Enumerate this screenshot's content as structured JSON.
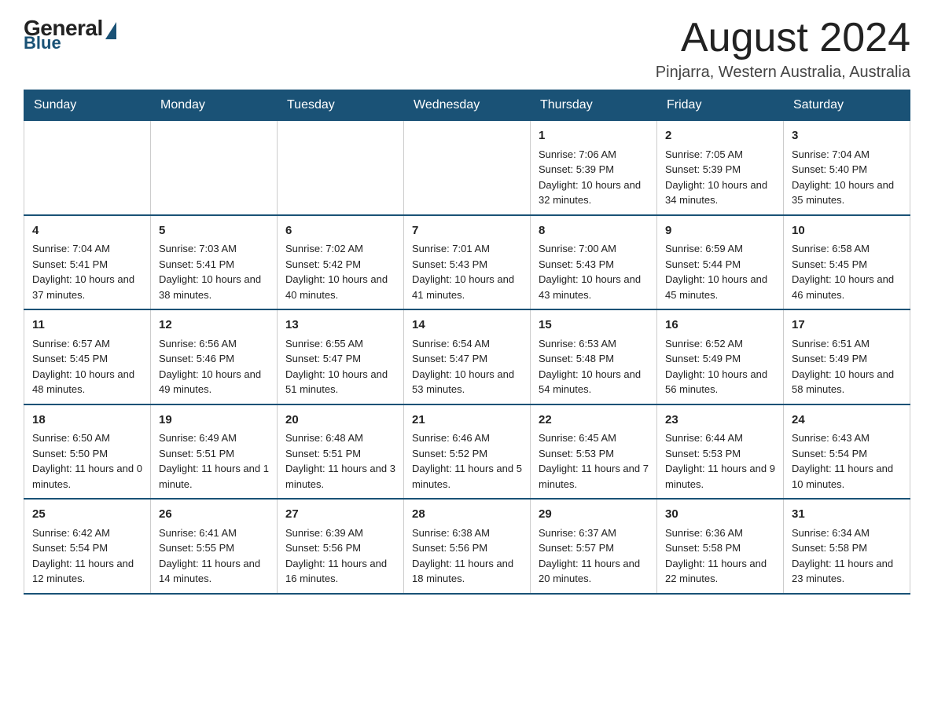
{
  "logo": {
    "general": "General",
    "blue": "Blue"
  },
  "title": "August 2024",
  "location": "Pinjarra, Western Australia, Australia",
  "days_of_week": [
    "Sunday",
    "Monday",
    "Tuesday",
    "Wednesday",
    "Thursday",
    "Friday",
    "Saturday"
  ],
  "weeks": [
    [
      {
        "day": "",
        "info": ""
      },
      {
        "day": "",
        "info": ""
      },
      {
        "day": "",
        "info": ""
      },
      {
        "day": "",
        "info": ""
      },
      {
        "day": "1",
        "info": "Sunrise: 7:06 AM\nSunset: 5:39 PM\nDaylight: 10 hours and 32 minutes."
      },
      {
        "day": "2",
        "info": "Sunrise: 7:05 AM\nSunset: 5:39 PM\nDaylight: 10 hours and 34 minutes."
      },
      {
        "day": "3",
        "info": "Sunrise: 7:04 AM\nSunset: 5:40 PM\nDaylight: 10 hours and 35 minutes."
      }
    ],
    [
      {
        "day": "4",
        "info": "Sunrise: 7:04 AM\nSunset: 5:41 PM\nDaylight: 10 hours and 37 minutes."
      },
      {
        "day": "5",
        "info": "Sunrise: 7:03 AM\nSunset: 5:41 PM\nDaylight: 10 hours and 38 minutes."
      },
      {
        "day": "6",
        "info": "Sunrise: 7:02 AM\nSunset: 5:42 PM\nDaylight: 10 hours and 40 minutes."
      },
      {
        "day": "7",
        "info": "Sunrise: 7:01 AM\nSunset: 5:43 PM\nDaylight: 10 hours and 41 minutes."
      },
      {
        "day": "8",
        "info": "Sunrise: 7:00 AM\nSunset: 5:43 PM\nDaylight: 10 hours and 43 minutes."
      },
      {
        "day": "9",
        "info": "Sunrise: 6:59 AM\nSunset: 5:44 PM\nDaylight: 10 hours and 45 minutes."
      },
      {
        "day": "10",
        "info": "Sunrise: 6:58 AM\nSunset: 5:45 PM\nDaylight: 10 hours and 46 minutes."
      }
    ],
    [
      {
        "day": "11",
        "info": "Sunrise: 6:57 AM\nSunset: 5:45 PM\nDaylight: 10 hours and 48 minutes."
      },
      {
        "day": "12",
        "info": "Sunrise: 6:56 AM\nSunset: 5:46 PM\nDaylight: 10 hours and 49 minutes."
      },
      {
        "day": "13",
        "info": "Sunrise: 6:55 AM\nSunset: 5:47 PM\nDaylight: 10 hours and 51 minutes."
      },
      {
        "day": "14",
        "info": "Sunrise: 6:54 AM\nSunset: 5:47 PM\nDaylight: 10 hours and 53 minutes."
      },
      {
        "day": "15",
        "info": "Sunrise: 6:53 AM\nSunset: 5:48 PM\nDaylight: 10 hours and 54 minutes."
      },
      {
        "day": "16",
        "info": "Sunrise: 6:52 AM\nSunset: 5:49 PM\nDaylight: 10 hours and 56 minutes."
      },
      {
        "day": "17",
        "info": "Sunrise: 6:51 AM\nSunset: 5:49 PM\nDaylight: 10 hours and 58 minutes."
      }
    ],
    [
      {
        "day": "18",
        "info": "Sunrise: 6:50 AM\nSunset: 5:50 PM\nDaylight: 11 hours and 0 minutes."
      },
      {
        "day": "19",
        "info": "Sunrise: 6:49 AM\nSunset: 5:51 PM\nDaylight: 11 hours and 1 minute."
      },
      {
        "day": "20",
        "info": "Sunrise: 6:48 AM\nSunset: 5:51 PM\nDaylight: 11 hours and 3 minutes."
      },
      {
        "day": "21",
        "info": "Sunrise: 6:46 AM\nSunset: 5:52 PM\nDaylight: 11 hours and 5 minutes."
      },
      {
        "day": "22",
        "info": "Sunrise: 6:45 AM\nSunset: 5:53 PM\nDaylight: 11 hours and 7 minutes."
      },
      {
        "day": "23",
        "info": "Sunrise: 6:44 AM\nSunset: 5:53 PM\nDaylight: 11 hours and 9 minutes."
      },
      {
        "day": "24",
        "info": "Sunrise: 6:43 AM\nSunset: 5:54 PM\nDaylight: 11 hours and 10 minutes."
      }
    ],
    [
      {
        "day": "25",
        "info": "Sunrise: 6:42 AM\nSunset: 5:54 PM\nDaylight: 11 hours and 12 minutes."
      },
      {
        "day": "26",
        "info": "Sunrise: 6:41 AM\nSunset: 5:55 PM\nDaylight: 11 hours and 14 minutes."
      },
      {
        "day": "27",
        "info": "Sunrise: 6:39 AM\nSunset: 5:56 PM\nDaylight: 11 hours and 16 minutes."
      },
      {
        "day": "28",
        "info": "Sunrise: 6:38 AM\nSunset: 5:56 PM\nDaylight: 11 hours and 18 minutes."
      },
      {
        "day": "29",
        "info": "Sunrise: 6:37 AM\nSunset: 5:57 PM\nDaylight: 11 hours and 20 minutes."
      },
      {
        "day": "30",
        "info": "Sunrise: 6:36 AM\nSunset: 5:58 PM\nDaylight: 11 hours and 22 minutes."
      },
      {
        "day": "31",
        "info": "Sunrise: 6:34 AM\nSunset: 5:58 PM\nDaylight: 11 hours and 23 minutes."
      }
    ]
  ]
}
